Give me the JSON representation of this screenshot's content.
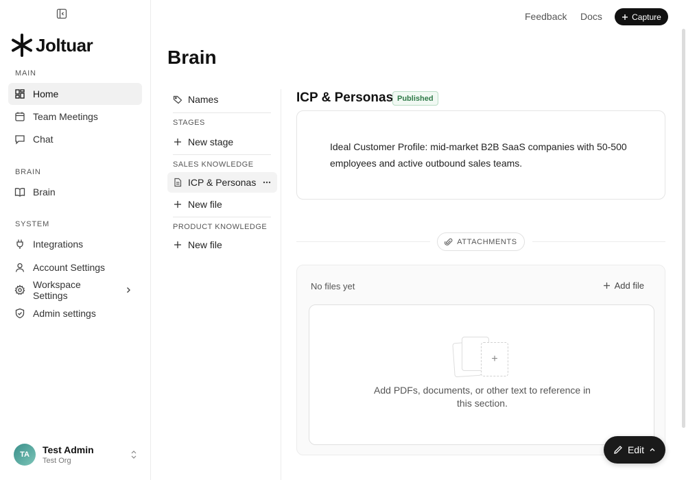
{
  "topbar": {
    "feedback_label": "Feedback",
    "docs_label": "Docs",
    "capture_label": "Capture"
  },
  "sidebar": {
    "logo_text": "Joltuar",
    "sections": {
      "main": "MAIN",
      "brain": "BRAIN",
      "system": "SYSTEM"
    },
    "items": {
      "home": "Home",
      "team_meetings": "Team Meetings",
      "chat": "Chat",
      "brain": "Brain",
      "integrations": "Integrations",
      "account_settings": "Account Settings",
      "workspace_settings": "Workspace Settings",
      "admin_settings": "Admin settings"
    },
    "user": {
      "initials": "TA",
      "name": "Test Admin",
      "org": "Test Org"
    }
  },
  "page": {
    "title": "Brain"
  },
  "tree": {
    "names": "Names",
    "stages_label": "STAGES",
    "new_stage": "New stage",
    "sales_label": "SALES KNOWLEDGE",
    "icp": "ICP & Personas",
    "new_file_sales": "New file",
    "product_label": "PRODUCT KNOWLEDGE",
    "new_file_product": "New file"
  },
  "document": {
    "title": "ICP & Personas",
    "status": "Published",
    "body": "Ideal Customer Profile: mid-market B2B SaaS companies with 50-500 employees and active outbound sales teams."
  },
  "attachments": {
    "label": "ATTACHMENTS",
    "empty": "No files yet",
    "add_file": "Add file",
    "drop_text": "Add PDFs, documents, or other text to reference in this section."
  },
  "edit_label": "Edit",
  "colors": {
    "accent": "#111111",
    "published_green": "#2f7a48",
    "avatar": "#3a8f8a"
  }
}
